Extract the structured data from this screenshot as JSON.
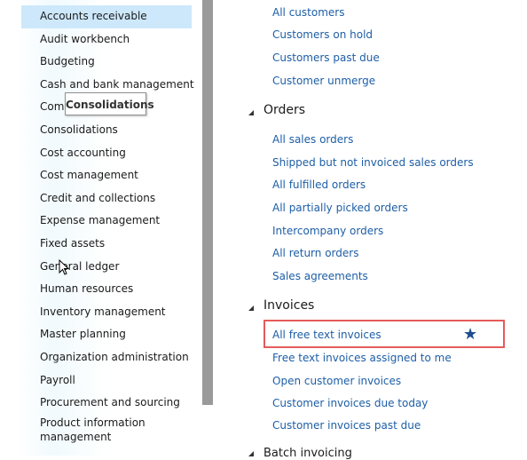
{
  "modules": [
    {
      "label": "Accounts receivable",
      "selected": true
    },
    {
      "label": "Audit workbench"
    },
    {
      "label": "Budgeting"
    },
    {
      "label": "Cash and bank management"
    },
    {
      "label": "Comm"
    },
    {
      "label": "Consolidations"
    },
    {
      "label": "Cost accounting"
    },
    {
      "label": "Cost management"
    },
    {
      "label": "Credit and collections"
    },
    {
      "label": "Expense management"
    },
    {
      "label": "Fixed assets"
    },
    {
      "label": "General ledger"
    },
    {
      "label": "Human resources"
    },
    {
      "label": "Inventory management"
    },
    {
      "label": "Master planning"
    },
    {
      "label": "Organization administration"
    },
    {
      "label": "Payroll"
    },
    {
      "label": "Procurement and sourcing"
    },
    {
      "label": "Product information management"
    }
  ],
  "tooltip": "Consolidations",
  "customers_links": [
    "All customers",
    "Customers on hold",
    "Customers past due",
    "Customer unmerge"
  ],
  "sections": {
    "orders": {
      "label": "Orders",
      "links": [
        "All sales orders",
        "Shipped but not invoiced sales orders",
        "All fulfilled orders",
        "All partially picked orders",
        "Intercompany orders",
        "All return orders",
        "Sales agreements"
      ]
    },
    "invoices": {
      "label": "Invoices",
      "links": [
        "All free text invoices",
        "Free text invoices assigned to me",
        "Open customer invoices",
        "Customer invoices due today",
        "Customer invoices past due"
      ]
    },
    "batch": {
      "label": "Batch invoicing"
    }
  },
  "colors": {
    "link": "#1d5ea6",
    "selected": "#cde8fb",
    "highlight": "#e55b5b",
    "star": "#1d4e8f"
  },
  "icons": {
    "favorite": "star-icon",
    "collapse": "triangle-down-icon",
    "cursor": "mouse-pointer-icon"
  }
}
